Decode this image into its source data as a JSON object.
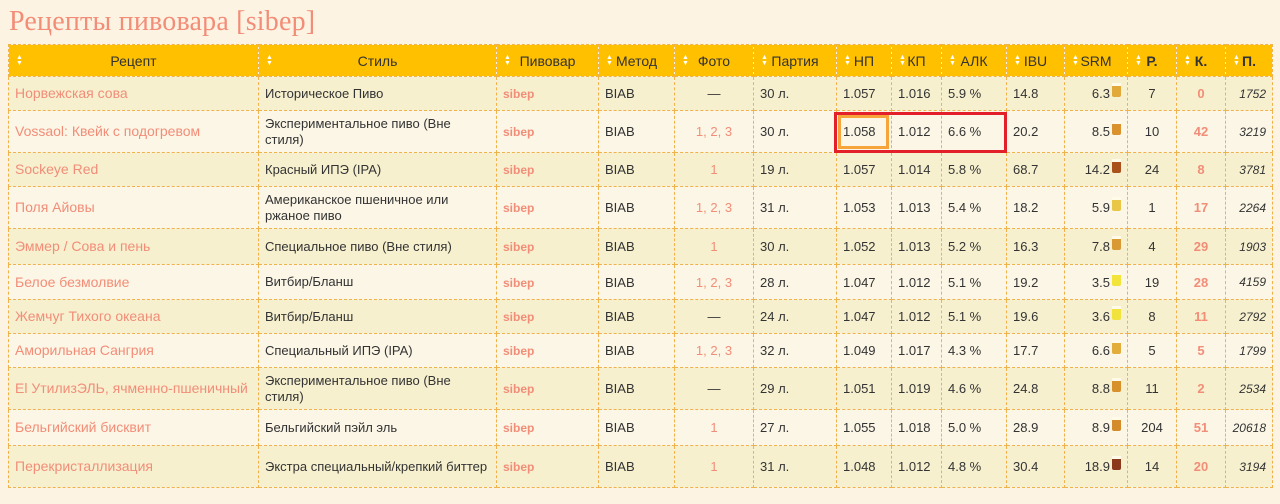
{
  "page": {
    "title": "Рецепты пивовара [sibep]"
  },
  "columns": [
    {
      "key": "recipe",
      "label": "Рецепт",
      "bold": false
    },
    {
      "key": "style",
      "label": "Стиль",
      "bold": false
    },
    {
      "key": "brewer",
      "label": "Пивовар",
      "bold": false
    },
    {
      "key": "method",
      "label": "Метод",
      "bold": false
    },
    {
      "key": "photo",
      "label": "Фото",
      "bold": false
    },
    {
      "key": "batch",
      "label": "Партия",
      "bold": false
    },
    {
      "key": "og",
      "label": "НП",
      "bold": false
    },
    {
      "key": "fg",
      "label": "КП",
      "bold": false
    },
    {
      "key": "abv",
      "label": "АЛК",
      "bold": false
    },
    {
      "key": "ibu",
      "label": "IBU",
      "bold": false
    },
    {
      "key": "srm",
      "label": "SRM",
      "bold": false
    },
    {
      "key": "r",
      "label": "Р.",
      "bold": true
    },
    {
      "key": "k",
      "label": "К.",
      "bold": true
    },
    {
      "key": "p",
      "label": "П.",
      "bold": true
    }
  ],
  "rows": [
    {
      "name": "Норвежская сова",
      "style": "Историческое Пиво",
      "brewer": "sibep",
      "method": "BIAB",
      "photo": "—",
      "batch": "30 л.",
      "og": "1.057",
      "fg": "1.016",
      "abv": "5.9 %",
      "ibu": "14.8",
      "srm": "6.3",
      "srm_color": "#e0a93a",
      "r": "7",
      "k": "0",
      "p": "1752"
    },
    {
      "name": "Vossaol: Квейк с подогревом",
      "style": "Экспериментальное пиво (Вне стиля)",
      "brewer": "sibep",
      "method": "BIAB",
      "photo": "1, 2, 3",
      "batch": "30 л.",
      "og": "1.058",
      "fg": "1.012",
      "abv": "6.6 %",
      "ibu": "20.2",
      "srm": "8.5",
      "srm_color": "#d9922c",
      "r": "10",
      "k": "42",
      "p": "3219"
    },
    {
      "name": "Sockeye Red",
      "style": "Красный ИПЭ (IPA)",
      "brewer": "sibep",
      "method": "BIAB",
      "photo": "1",
      "batch": "19 л.",
      "og": "1.057",
      "fg": "1.014",
      "abv": "5.8 %",
      "ibu": "68.7",
      "srm": "14.2",
      "srm_color": "#a9521c",
      "r": "24",
      "k": "8",
      "p": "3781"
    },
    {
      "name": "Поля Айовы",
      "style": "Американское пшеничное или ржаное пиво",
      "brewer": "sibep",
      "method": "BIAB",
      "photo": "1, 2, 3",
      "batch": "31 л.",
      "og": "1.053",
      "fg": "1.013",
      "abv": "5.4 %",
      "ibu": "18.2",
      "srm": "5.9",
      "srm_color": "#e9c646",
      "r": "1",
      "k": "17",
      "p": "2264"
    },
    {
      "name": "Эммер / Сова и пень",
      "style": "Специальное пиво (Вне стиля)",
      "brewer": "sibep",
      "method": "BIAB",
      "photo": "1",
      "batch": "30 л.",
      "og": "1.052",
      "fg": "1.013",
      "abv": "5.2 %",
      "ibu": "16.3",
      "srm": "7.8",
      "srm_color": "#d99a33",
      "r": "4",
      "k": "29",
      "p": "1903"
    },
    {
      "name": "Белое безмолвие",
      "style": "Витбир/Бланш",
      "brewer": "sibep",
      "method": "BIAB",
      "photo": "1, 2, 3",
      "batch": "28 л.",
      "og": "1.047",
      "fg": "1.012",
      "abv": "5.1 %",
      "ibu": "19.2",
      "srm": "3.5",
      "srm_color": "#f2e43a",
      "r": "19",
      "k": "28",
      "p": "4159"
    },
    {
      "name": "Жемчуг Тихого океана",
      "style": "Витбир/Бланш",
      "brewer": "sibep",
      "method": "BIAB",
      "photo": "—",
      "batch": "24 л.",
      "og": "1.047",
      "fg": "1.012",
      "abv": "5.1 %",
      "ibu": "19.6",
      "srm": "3.6",
      "srm_color": "#f2e23c",
      "r": "8",
      "k": "11",
      "p": "2792"
    },
    {
      "name": "Аморильная Сангрия",
      "style": "Специальный ИПЭ (IPA)",
      "brewer": "sibep",
      "method": "BIAB",
      "photo": "1, 2, 3",
      "batch": "32 л.",
      "og": "1.049",
      "fg": "1.017",
      "abv": "4.3 %",
      "ibu": "17.7",
      "srm": "6.6",
      "srm_color": "#e3ad3c",
      "r": "5",
      "k": "5",
      "p": "1799"
    },
    {
      "name": "El УтилизЭЛЬ, ячменно-пшеничный",
      "style": "Экспериментальное пиво (Вне стиля)",
      "brewer": "sibep",
      "method": "BIAB",
      "photo": "—",
      "batch": "29 л.",
      "og": "1.051",
      "fg": "1.019",
      "abv": "4.6 %",
      "ibu": "24.8",
      "srm": "8.8",
      "srm_color": "#d8902b",
      "r": "11",
      "k": "2",
      "p": "2534"
    },
    {
      "name": "Бельгийский бисквит",
      "style": "Бельгийский пэйл эль",
      "brewer": "sibep",
      "method": "BIAB",
      "photo": "1",
      "batch": "27 л.",
      "og": "1.055",
      "fg": "1.018",
      "abv": "5.0 %",
      "ibu": "28.9",
      "srm": "8.9",
      "srm_color": "#d48c2b",
      "r": "204",
      "k": "51",
      "p": "20618"
    },
    {
      "name": "Перекристаллизация",
      "style": "Экстра специальный/крепкий биттер",
      "brewer": "sibep",
      "method": "BIAB",
      "photo": "1",
      "batch": "31 л.",
      "og": "1.048",
      "fg": "1.012",
      "abv": "4.8 %",
      "ibu": "30.4",
      "srm": "18.9",
      "srm_color": "#8a3a1a",
      "r": "14",
      "k": "20",
      "p": "3194"
    }
  ],
  "icons": {
    "sort": "sort-arrows-icon",
    "glass": "beer-glass-icon"
  },
  "colors": {
    "header": "#ffc000",
    "link": "#f28d78",
    "highlight_red": "#e3202a",
    "highlight_orange": "#f7a43a"
  }
}
